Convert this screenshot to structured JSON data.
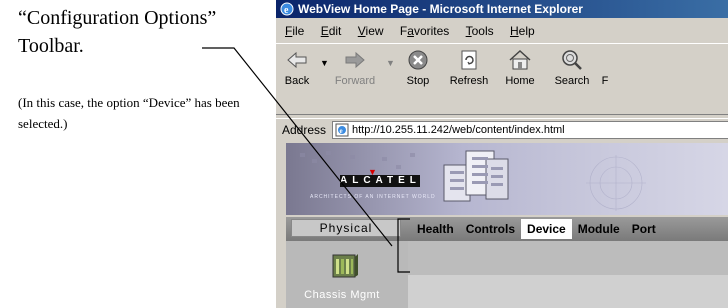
{
  "annotation": {
    "caption": "“Configuration Options” Toolbar.",
    "note": "(In this case, the option “Device” has been selected.)"
  },
  "browser": {
    "title": "WebView Home Page - Microsoft Internet Explorer",
    "menu": [
      {
        "u": "F",
        "rest": "ile"
      },
      {
        "u": "E",
        "rest": "dit"
      },
      {
        "u": "V",
        "rest": "iew"
      },
      {
        "pre": "F",
        "u": "a",
        "rest": "vorites"
      },
      {
        "u": "T",
        "rest": "ools"
      },
      {
        "u": "H",
        "rest": "elp"
      }
    ],
    "toolbar": {
      "back": "Back",
      "forward": "Forward",
      "stop": "Stop",
      "refresh": "Refresh",
      "home": "Home",
      "search": "Search",
      "cut_off": "F"
    },
    "address": {
      "label": "Address",
      "url": "http://10.255.11.242/web/content/index.html"
    }
  },
  "page": {
    "logo": "ALCATEL",
    "tagline": "ARCHITECTS OF AN INTERNET WORLD",
    "physical": "Physical",
    "tabs": [
      "Health",
      "Controls",
      "Device",
      "Module",
      "Port"
    ],
    "active_tab": "Device",
    "left_item": "Chassis Mgmt"
  },
  "colors": {
    "title_bar": "#0a246a",
    "active_tab_bg": "#ffffff",
    "tab_bar": "#8a8a8a"
  }
}
